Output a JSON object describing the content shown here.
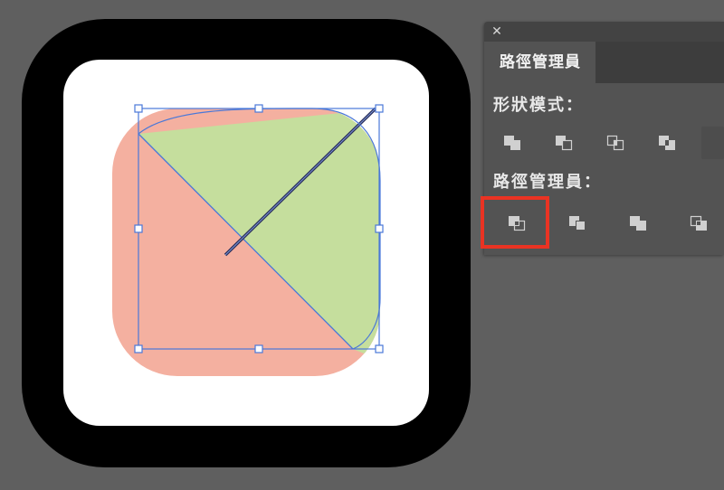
{
  "panel": {
    "title": "路徑管理員",
    "close_label": "✕",
    "shape_modes_label": "形狀模式：",
    "pathfinders_label": "路徑管理員：",
    "shape_mode_buttons": [
      "unite-icon",
      "minus-front-icon",
      "intersect-icon",
      "exclude-icon"
    ],
    "pathfinder_buttons": [
      "divide-icon",
      "trim-icon",
      "merge-icon",
      "crop-icon"
    ],
    "highlighted_button": "divide-icon"
  },
  "colors": {
    "background": "#5f5f5f",
    "icon_frame": "#000000",
    "icon_inner": "#ffffff",
    "shape_green": "#c5de9d",
    "shape_salmon": "#f4b0a0",
    "selection": "#4a78d8",
    "highlight": "#ea3323"
  }
}
